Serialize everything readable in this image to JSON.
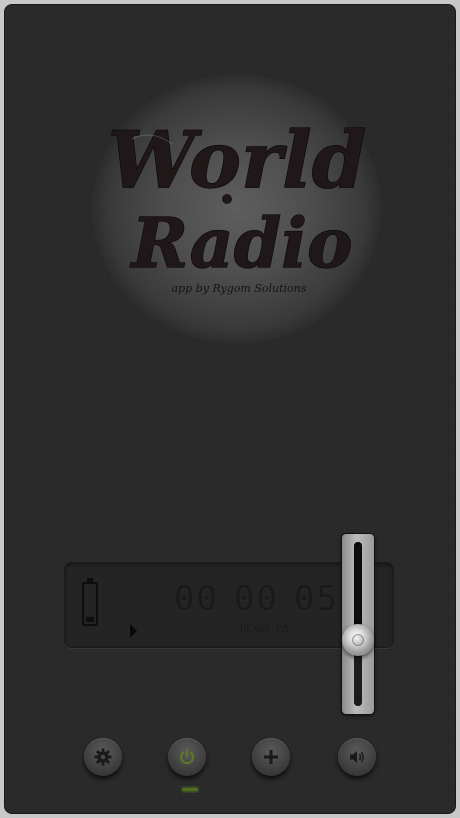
{
  "app": {
    "logo_line1": "World",
    "logo_line2": "Radio",
    "credit": "app by Rygom Solutions"
  },
  "display": {
    "hours": "00",
    "minutes": "00",
    "seconds": "05",
    "frequency": "ПЕХ08 РЛ",
    "battery_level": 0.15
  },
  "volume": {
    "level": 0.4
  },
  "controls": [
    {
      "icon": "gear-icon"
    },
    {
      "icon": "power-icon"
    },
    {
      "icon": "add-icon"
    },
    {
      "icon": "speaker-icon"
    }
  ],
  "colors": {
    "background": "#2a2a2a",
    "power_led": "#6a8e2a"
  }
}
